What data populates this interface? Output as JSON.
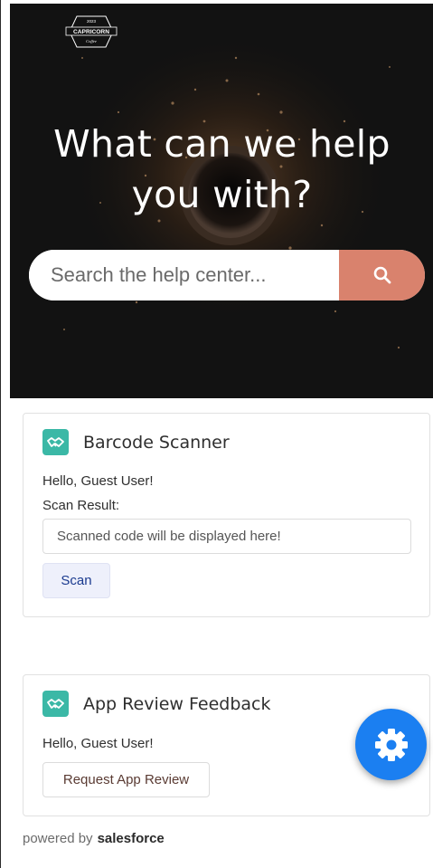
{
  "hero": {
    "logo_brand": "CAPRICORN",
    "logo_year": "2023",
    "logo_sub": "Coffee",
    "title_line1": "What can we help",
    "title_line2": "you with?",
    "search_placeholder": "Search the help center...",
    "search_button_icon": "search-icon"
  },
  "barcode_card": {
    "title": "Barcode Scanner",
    "icon": "handshake-icon",
    "greeting": "Hello, Guest User!",
    "scan_result_label": "Scan Result:",
    "result_placeholder": "Scanned code will be displayed here!",
    "scan_button": "Scan"
  },
  "review_card": {
    "title": "App Review Feedback",
    "icon": "handshake-icon",
    "greeting": "Hello, Guest User!",
    "request_button": "Request App Review"
  },
  "fab": {
    "icon": "gear-icon"
  },
  "footer": {
    "powered_by": "powered by",
    "brand": "salesforce"
  },
  "colors": {
    "hero_bg": "#121212",
    "search_button": "#d9826d",
    "card_icon": "#3bb8a6",
    "fab": "#1b7ff1",
    "scan_button_text": "#1a3a8f"
  }
}
